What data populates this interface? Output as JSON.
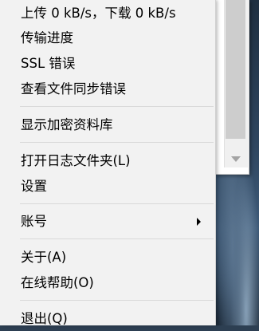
{
  "menu": {
    "status": "上传 0 kB/s，下载 0 kB/s",
    "transfer_progress": "传输进度",
    "ssl_errors": "SSL 错误",
    "view_sync_errors": "查看文件同步错误",
    "show_encrypted_vault": "显示加密资料库",
    "open_log_folder": "打开日志文件夹(L)",
    "settings": "设置",
    "account": "账号",
    "about": "关于(A)",
    "online_help": "在线帮助(O)",
    "quit": "退出(Q)"
  },
  "icons": {
    "account_submenu": "chevron-right-icon",
    "scroll_down": "triangle-down-icon"
  },
  "colors": {
    "menu_background": "#f2f2f2",
    "separator": "#d9d9d9",
    "text": "#000000"
  }
}
